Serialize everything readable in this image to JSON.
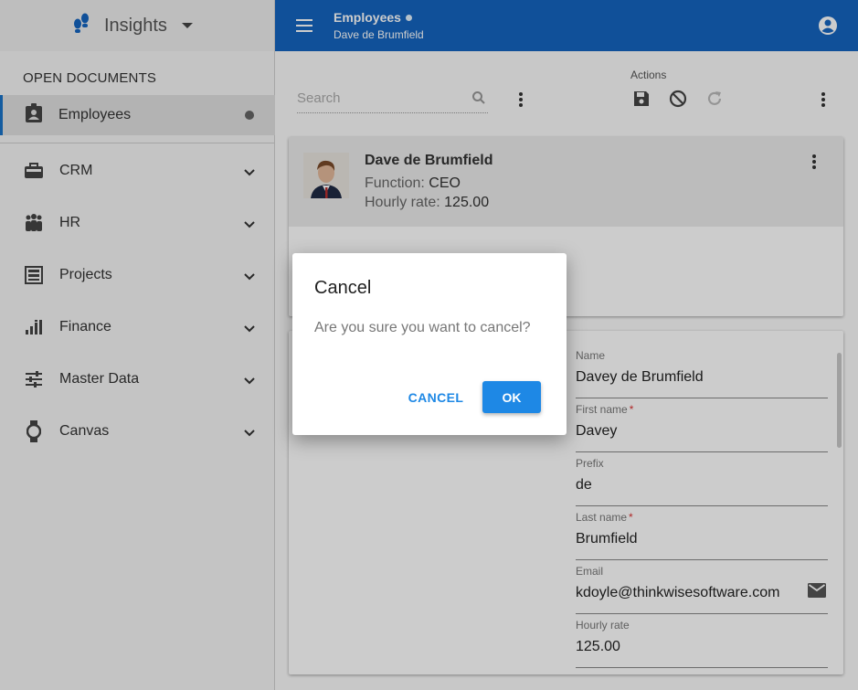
{
  "app": {
    "brand": "Insights",
    "brand_icon": "footsteps-icon"
  },
  "sidebar": {
    "section_title": "OPEN DOCUMENTS",
    "open_document": {
      "label": "Employees",
      "icon": "badge-icon",
      "modified": true
    },
    "items": [
      {
        "label": "CRM",
        "icon": "briefcase-icon"
      },
      {
        "label": "HR",
        "icon": "people-icon"
      },
      {
        "label": "Projects",
        "icon": "server-icon"
      },
      {
        "label": "Finance",
        "icon": "signal-icon"
      },
      {
        "label": "Master Data",
        "icon": "sliders-icon"
      },
      {
        "label": "Canvas",
        "icon": "watch-icon"
      }
    ]
  },
  "topbar": {
    "title": "Employees",
    "subtitle": "Dave de Brumfield",
    "color": "#1565c0"
  },
  "toolbar": {
    "search_placeholder": "Search",
    "actions_label": "Actions",
    "action_icons": [
      "save-icon",
      "cancel-icon",
      "refresh-icon"
    ]
  },
  "employee": {
    "name": "Dave de Brumfield",
    "function_label": "Function:",
    "function_value": "CEO",
    "rate_label": "Hourly rate:",
    "rate_value": "125.00"
  },
  "form": {
    "fields": [
      {
        "label": "Name",
        "value": "Davey de Brumfield",
        "required": false
      },
      {
        "label": "First name",
        "value": "Davey",
        "required": true
      },
      {
        "label": "Prefix",
        "value": "de",
        "required": false
      },
      {
        "label": "Last name",
        "value": "Brumfield",
        "required": true
      },
      {
        "label": "Email",
        "value": "kdoyle@thinkwisesoftware.com",
        "required": false
      },
      {
        "label": "Hourly rate",
        "value": "125.00",
        "required": false
      }
    ],
    "required_mark": "*"
  },
  "dialog": {
    "title": "Cancel",
    "message": "Are you sure you want to cancel?",
    "cancel_label": "CANCEL",
    "ok_label": "OK",
    "accent": "#1e88e5"
  }
}
